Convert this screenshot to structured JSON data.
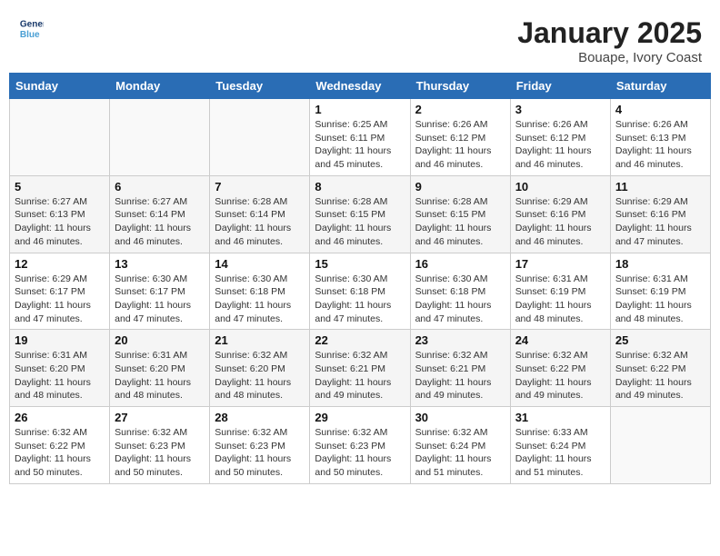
{
  "header": {
    "logo_line1": "General",
    "logo_line2": "Blue",
    "month": "January 2025",
    "location": "Bouape, Ivory Coast"
  },
  "days_of_week": [
    "Sunday",
    "Monday",
    "Tuesday",
    "Wednesday",
    "Thursday",
    "Friday",
    "Saturday"
  ],
  "weeks": [
    [
      {
        "day": "",
        "info": ""
      },
      {
        "day": "",
        "info": ""
      },
      {
        "day": "",
        "info": ""
      },
      {
        "day": "1",
        "info": "Sunrise: 6:25 AM\nSunset: 6:11 PM\nDaylight: 11 hours\nand 45 minutes."
      },
      {
        "day": "2",
        "info": "Sunrise: 6:26 AM\nSunset: 6:12 PM\nDaylight: 11 hours\nand 46 minutes."
      },
      {
        "day": "3",
        "info": "Sunrise: 6:26 AM\nSunset: 6:12 PM\nDaylight: 11 hours\nand 46 minutes."
      },
      {
        "day": "4",
        "info": "Sunrise: 6:26 AM\nSunset: 6:13 PM\nDaylight: 11 hours\nand 46 minutes."
      }
    ],
    [
      {
        "day": "5",
        "info": "Sunrise: 6:27 AM\nSunset: 6:13 PM\nDaylight: 11 hours\nand 46 minutes."
      },
      {
        "day": "6",
        "info": "Sunrise: 6:27 AM\nSunset: 6:14 PM\nDaylight: 11 hours\nand 46 minutes."
      },
      {
        "day": "7",
        "info": "Sunrise: 6:28 AM\nSunset: 6:14 PM\nDaylight: 11 hours\nand 46 minutes."
      },
      {
        "day": "8",
        "info": "Sunrise: 6:28 AM\nSunset: 6:15 PM\nDaylight: 11 hours\nand 46 minutes."
      },
      {
        "day": "9",
        "info": "Sunrise: 6:28 AM\nSunset: 6:15 PM\nDaylight: 11 hours\nand 46 minutes."
      },
      {
        "day": "10",
        "info": "Sunrise: 6:29 AM\nSunset: 6:16 PM\nDaylight: 11 hours\nand 46 minutes."
      },
      {
        "day": "11",
        "info": "Sunrise: 6:29 AM\nSunset: 6:16 PM\nDaylight: 11 hours\nand 47 minutes."
      }
    ],
    [
      {
        "day": "12",
        "info": "Sunrise: 6:29 AM\nSunset: 6:17 PM\nDaylight: 11 hours\nand 47 minutes."
      },
      {
        "day": "13",
        "info": "Sunrise: 6:30 AM\nSunset: 6:17 PM\nDaylight: 11 hours\nand 47 minutes."
      },
      {
        "day": "14",
        "info": "Sunrise: 6:30 AM\nSunset: 6:18 PM\nDaylight: 11 hours\nand 47 minutes."
      },
      {
        "day": "15",
        "info": "Sunrise: 6:30 AM\nSunset: 6:18 PM\nDaylight: 11 hours\nand 47 minutes."
      },
      {
        "day": "16",
        "info": "Sunrise: 6:30 AM\nSunset: 6:18 PM\nDaylight: 11 hours\nand 47 minutes."
      },
      {
        "day": "17",
        "info": "Sunrise: 6:31 AM\nSunset: 6:19 PM\nDaylight: 11 hours\nand 48 minutes."
      },
      {
        "day": "18",
        "info": "Sunrise: 6:31 AM\nSunset: 6:19 PM\nDaylight: 11 hours\nand 48 minutes."
      }
    ],
    [
      {
        "day": "19",
        "info": "Sunrise: 6:31 AM\nSunset: 6:20 PM\nDaylight: 11 hours\nand 48 minutes."
      },
      {
        "day": "20",
        "info": "Sunrise: 6:31 AM\nSunset: 6:20 PM\nDaylight: 11 hours\nand 48 minutes."
      },
      {
        "day": "21",
        "info": "Sunrise: 6:32 AM\nSunset: 6:20 PM\nDaylight: 11 hours\nand 48 minutes."
      },
      {
        "day": "22",
        "info": "Sunrise: 6:32 AM\nSunset: 6:21 PM\nDaylight: 11 hours\nand 49 minutes."
      },
      {
        "day": "23",
        "info": "Sunrise: 6:32 AM\nSunset: 6:21 PM\nDaylight: 11 hours\nand 49 minutes."
      },
      {
        "day": "24",
        "info": "Sunrise: 6:32 AM\nSunset: 6:22 PM\nDaylight: 11 hours\nand 49 minutes."
      },
      {
        "day": "25",
        "info": "Sunrise: 6:32 AM\nSunset: 6:22 PM\nDaylight: 11 hours\nand 49 minutes."
      }
    ],
    [
      {
        "day": "26",
        "info": "Sunrise: 6:32 AM\nSunset: 6:22 PM\nDaylight: 11 hours\nand 50 minutes."
      },
      {
        "day": "27",
        "info": "Sunrise: 6:32 AM\nSunset: 6:23 PM\nDaylight: 11 hours\nand 50 minutes."
      },
      {
        "day": "28",
        "info": "Sunrise: 6:32 AM\nSunset: 6:23 PM\nDaylight: 11 hours\nand 50 minutes."
      },
      {
        "day": "29",
        "info": "Sunrise: 6:32 AM\nSunset: 6:23 PM\nDaylight: 11 hours\nand 50 minutes."
      },
      {
        "day": "30",
        "info": "Sunrise: 6:32 AM\nSunset: 6:24 PM\nDaylight: 11 hours\nand 51 minutes."
      },
      {
        "day": "31",
        "info": "Sunrise: 6:33 AM\nSunset: 6:24 PM\nDaylight: 11 hours\nand 51 minutes."
      },
      {
        "day": "",
        "info": ""
      }
    ]
  ]
}
